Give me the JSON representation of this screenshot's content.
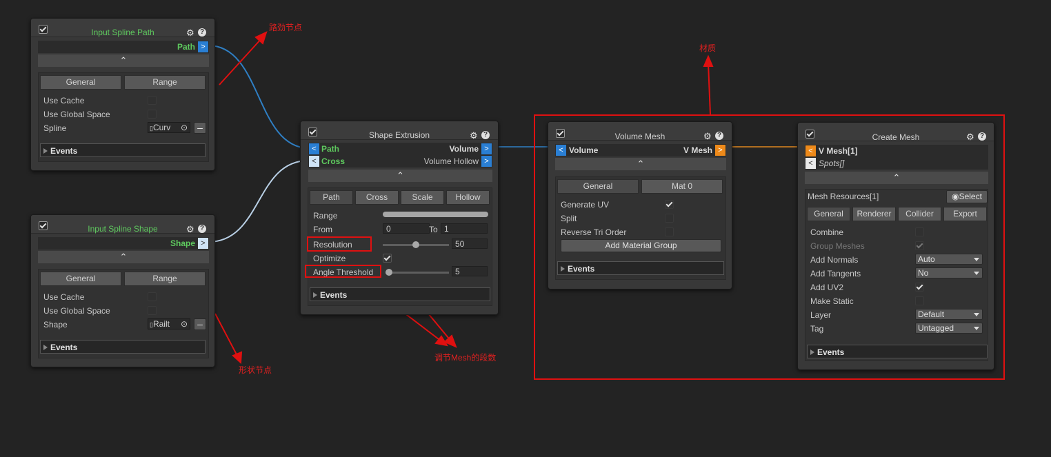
{
  "nodes": {
    "input_spline_path": {
      "title": "Input Spline Path",
      "output_port": "Path",
      "tabs": [
        "General",
        "Range"
      ],
      "props": {
        "use_cache": "Use Cache",
        "use_global_space": "Use Global Space",
        "spline": "Spline"
      },
      "spline_value": "Curv",
      "events": "Events"
    },
    "input_spline_shape": {
      "title": "Input Spline Shape",
      "output_port": "Shape",
      "tabs": [
        "General",
        "Range"
      ],
      "props": {
        "use_cache": "Use Cache",
        "use_global_space": "Use Global Space",
        "shape": "Shape"
      },
      "shape_value": "Railt",
      "events": "Events"
    },
    "shape_extrusion": {
      "title": "Shape Extrusion",
      "inputs": [
        "Path",
        "Cross"
      ],
      "outputs": [
        "Volume",
        "Volume Hollow"
      ],
      "tabs": [
        "Path",
        "Cross",
        "Scale",
        "Hollow"
      ],
      "range_label": "Range",
      "from_label": "From",
      "from_value": "0",
      "to_label": "To",
      "to_value": "1",
      "resolution_label": "Resolution",
      "resolution_value": "50",
      "optimize_label": "Optimize",
      "angle_threshold_label": "Angle Threshold",
      "angle_threshold_value": "5",
      "events": "Events"
    },
    "volume_mesh": {
      "title": "Volume Mesh",
      "input": "Volume",
      "output": "V Mesh",
      "tabs": [
        "General",
        "Mat 0"
      ],
      "generate_uv": "Generate UV",
      "split": "Split",
      "reverse_tri_order": "Reverse Tri Order",
      "add_material_group": "Add Material Group",
      "events": "Events"
    },
    "create_mesh": {
      "title": "Create Mesh",
      "inputs": [
        "V Mesh[1]",
        "Spots[]"
      ],
      "mesh_resources": "Mesh Resources[1]",
      "select_button": "Select",
      "tabs": [
        "General",
        "Renderer",
        "Collider",
        "Export"
      ],
      "combine": "Combine",
      "group_meshes": "Group Meshes",
      "add_normals": "Add Normals",
      "add_normals_value": "Auto",
      "add_tangents": "Add Tangents",
      "add_tangents_value": "No",
      "add_uv2": "Add UV2",
      "make_static": "Make Static",
      "layer": "Layer",
      "layer_value": "Default",
      "tag": "Tag",
      "tag_value": "Untagged",
      "events": "Events"
    }
  },
  "annotations": {
    "path_node": "路劲节点",
    "material": "材质",
    "mesh_segments": "调节Mesh的段数",
    "shape_node": "形状节点"
  },
  "colors": {
    "background": "#232323",
    "node": "#383838",
    "port_blue": "#2a7fd4",
    "port_orange": "#ee8a1a",
    "annotation_red": "#e01010",
    "title_green": "#5ec95e"
  }
}
